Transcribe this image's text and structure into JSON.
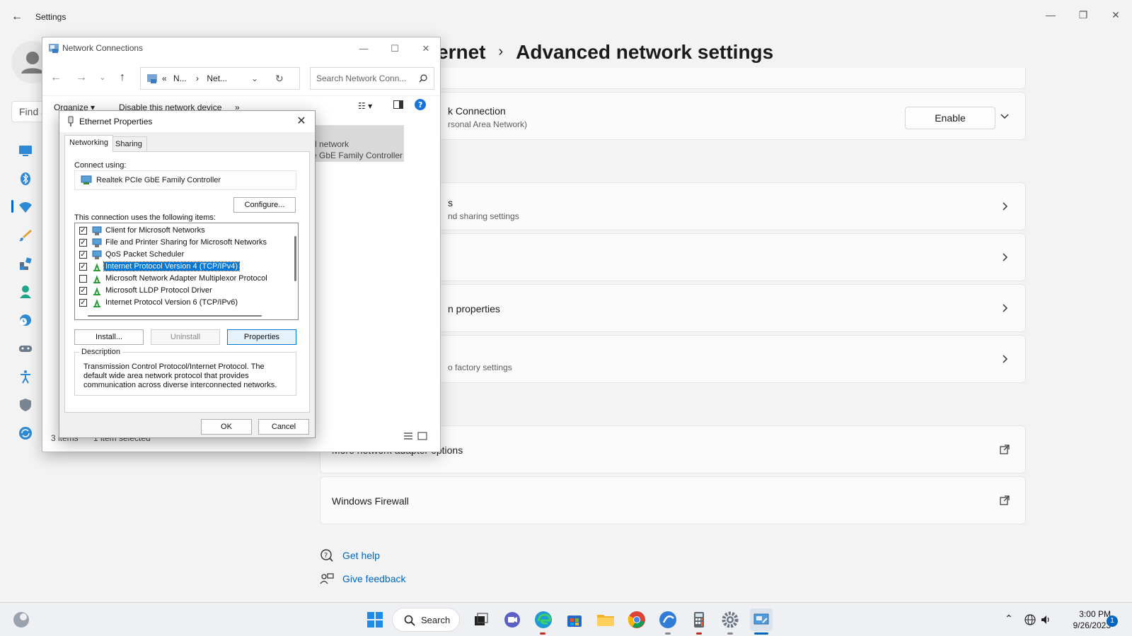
{
  "settings": {
    "app_title": "Settings",
    "find_placeholder": "Find a",
    "breadcrumb_parent": "ernet",
    "breadcrumb_current": "Advanced network settings",
    "cards": [
      {
        "title": "k Connection",
        "subtitle": "rsonal Area Network)",
        "action": "Enable"
      },
      {
        "title": "s",
        "subtitle": "nd sharing settings"
      },
      {
        "title": "",
        "subtitle": ""
      },
      {
        "title": "n properties",
        "subtitle": ""
      },
      {
        "title": "",
        "subtitle": "o factory settings"
      },
      {
        "title": "More network adapter options",
        "subtitle": ""
      },
      {
        "title": "Windows Firewall",
        "subtitle": ""
      }
    ],
    "help": {
      "get_help": "Get help",
      "give_feedback": "Give feedback"
    },
    "accent": "#0067c0"
  },
  "network_connections": {
    "title": "Network Connections",
    "address": [
      "«",
      "N...",
      "›",
      "Net..."
    ],
    "search_placeholder": "Search Network Conn...",
    "toolbar": {
      "organize": "Organize ▾",
      "disable": "Disable this network device",
      "more": "»"
    },
    "selected_item": {
      "line1": "d network",
      "line2": "e GbE Family Controller"
    },
    "status": {
      "items": "3 items",
      "selected": "1 item selected"
    }
  },
  "ethernet_properties": {
    "title": "Ethernet Properties",
    "tabs": [
      "Networking",
      "Sharing"
    ],
    "connect_using_label": "Connect using:",
    "adapter": "Realtek PCIe GbE Family Controller",
    "configure": "Configure...",
    "items_label": "This connection uses the following items:",
    "items": [
      {
        "label": "Client for Microsoft Networks",
        "checked": true,
        "icon": "network-client-icon"
      },
      {
        "label": "File and Printer Sharing for Microsoft Networks",
        "checked": true,
        "icon": "network-service-icon"
      },
      {
        "label": "QoS Packet Scheduler",
        "checked": true,
        "icon": "network-service-icon"
      },
      {
        "label": "Internet Protocol Version 4 (TCP/IPv4)",
        "checked": true,
        "icon": "protocol-icon",
        "selected": true
      },
      {
        "label": "Microsoft Network Adapter Multiplexor Protocol",
        "checked": false,
        "icon": "protocol-icon"
      },
      {
        "label": "Microsoft LLDP Protocol Driver",
        "checked": true,
        "icon": "protocol-icon"
      },
      {
        "label": "Internet Protocol Version 6 (TCP/IPv6)",
        "checked": true,
        "icon": "protocol-icon"
      }
    ],
    "install": "Install...",
    "uninstall": "Uninstall",
    "properties": "Properties",
    "description_label": "Description",
    "description": "Transmission Control Protocol/Internet Protocol. The default wide area network protocol that provides communication across diverse interconnected networks.",
    "ok": "OK",
    "cancel": "Cancel"
  },
  "taskbar": {
    "search": "Search",
    "time": "3:00 PM",
    "date": "9/26/2023",
    "notification_count": "1"
  }
}
